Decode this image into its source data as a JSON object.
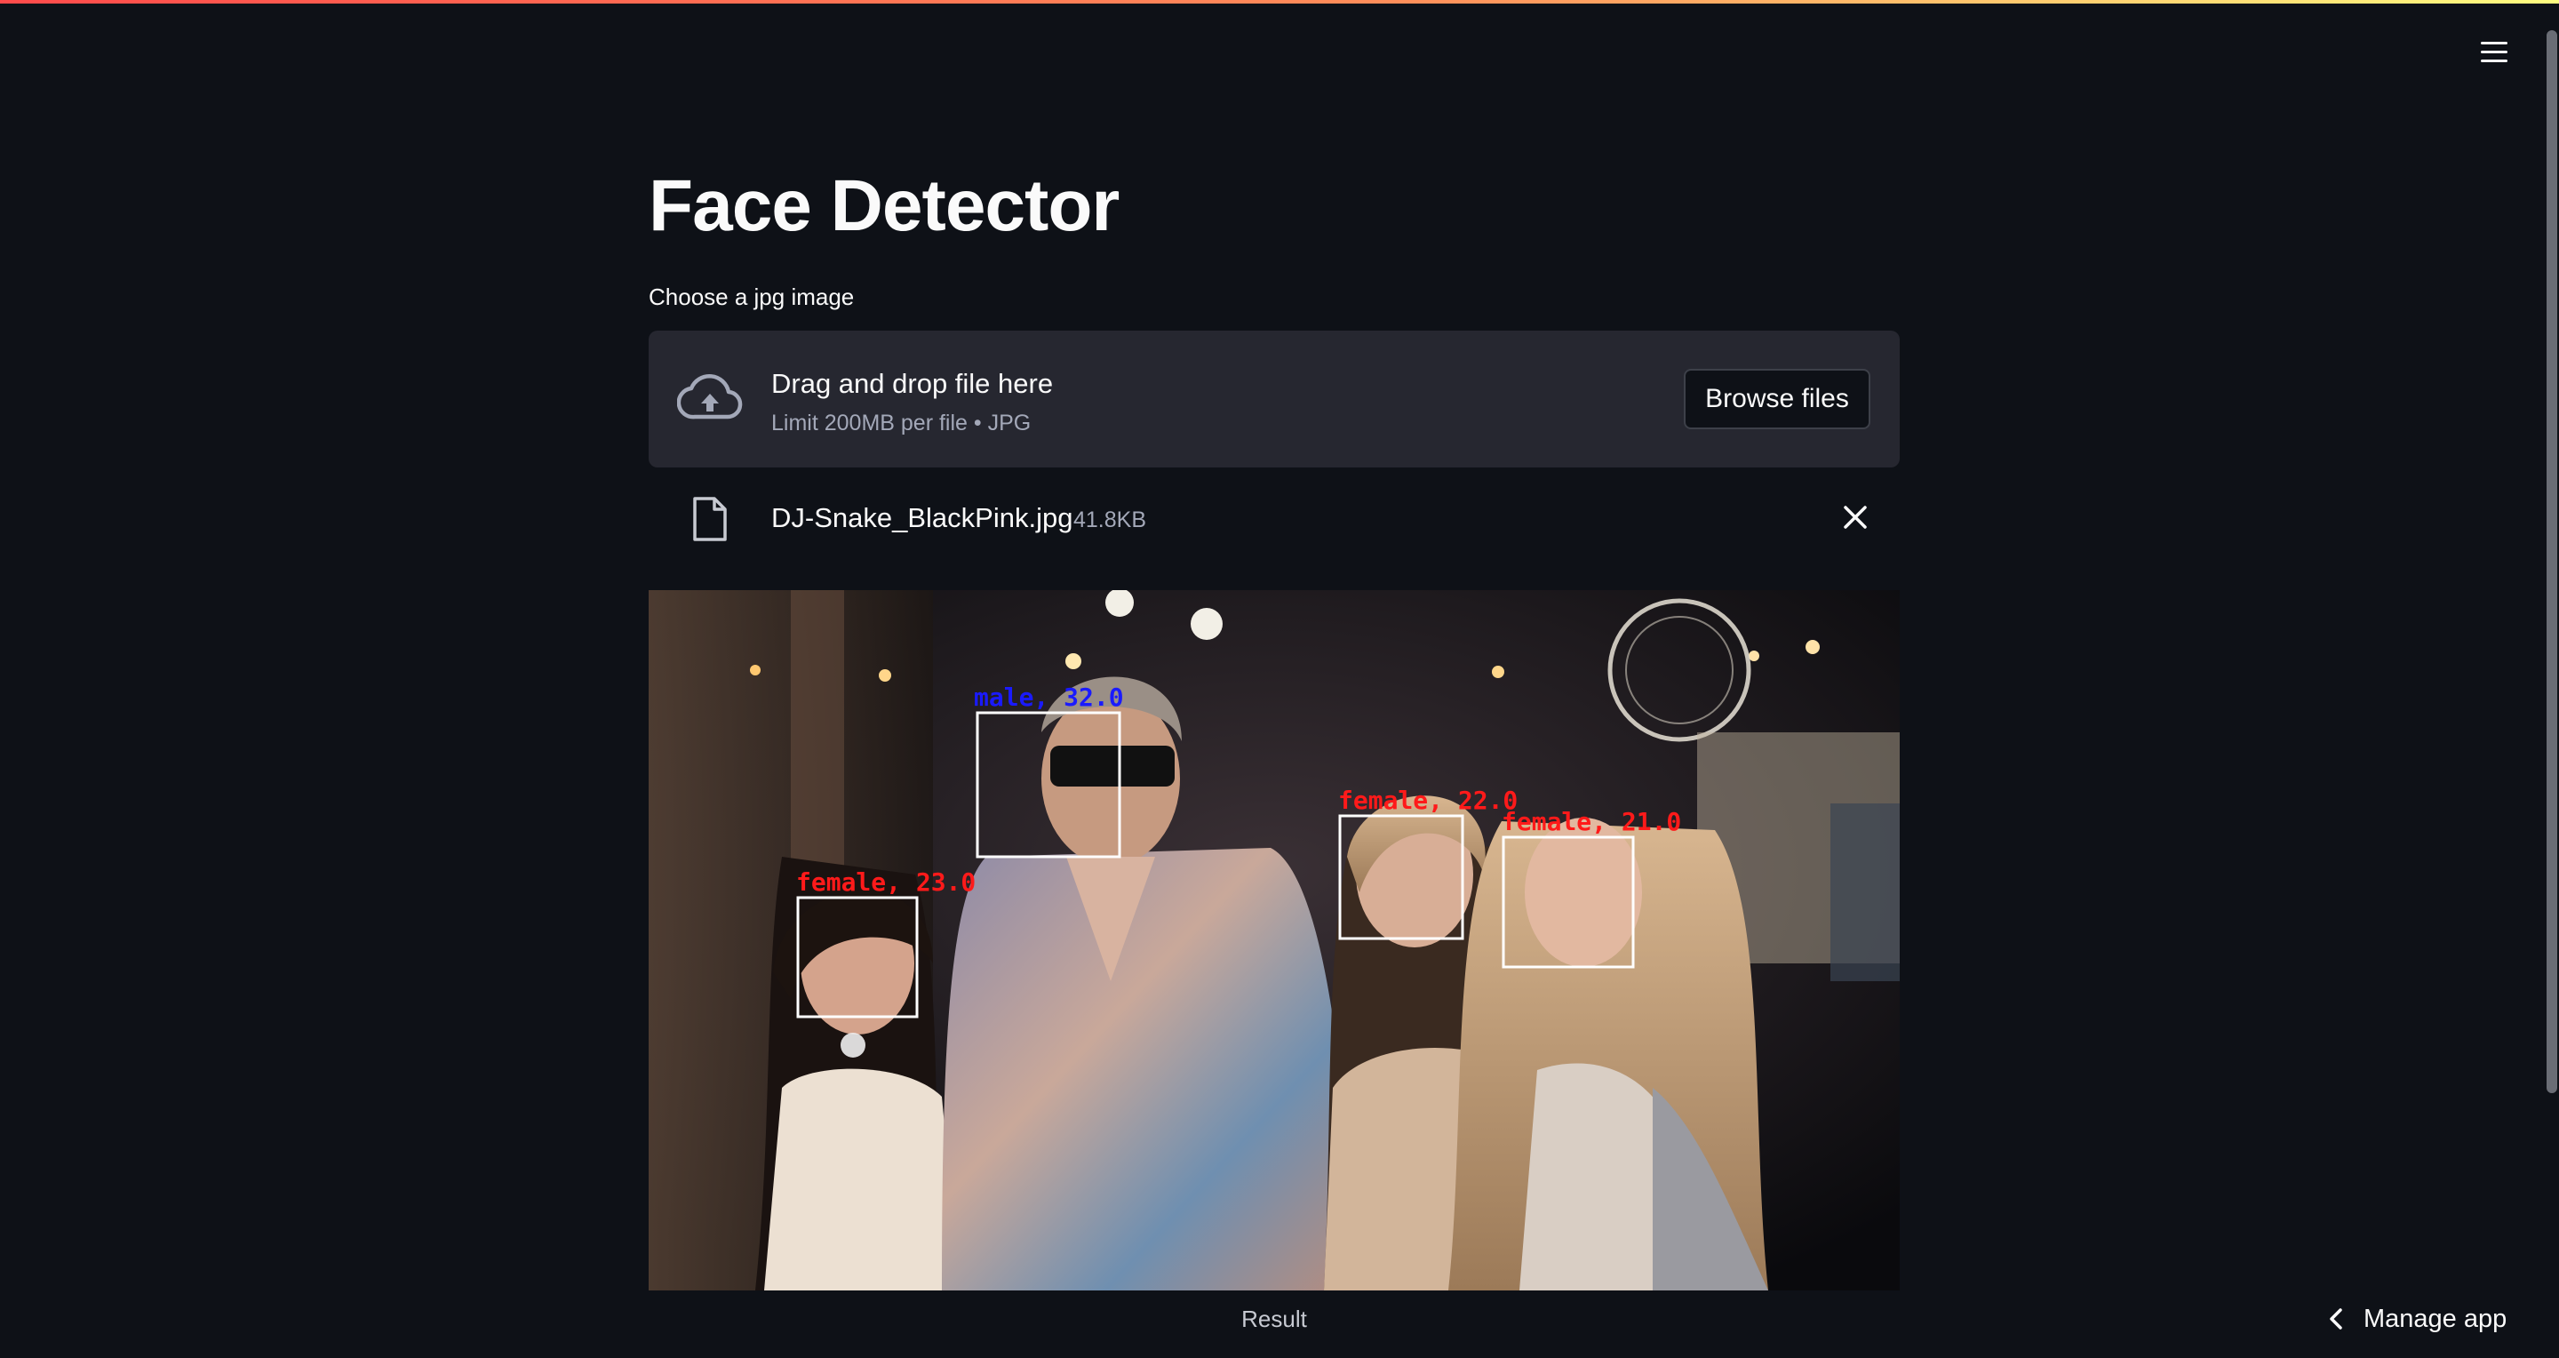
{
  "header": {
    "menu_icon": "hamburger-menu-icon"
  },
  "page": {
    "title": "Face Detector"
  },
  "uploader": {
    "label": "Choose a jpg image",
    "drop_text": "Drag and drop file here",
    "limit_text": "Limit 200MB per file • JPG",
    "browse_label": "Browse files",
    "upload_icon": "cloud-upload-icon"
  },
  "uploaded_file": {
    "name": "DJ-Snake_BlackPink.jpg",
    "size": "41.8KB",
    "file_icon": "file-icon",
    "remove_icon": "close-icon"
  },
  "result": {
    "caption": "Result",
    "detections": [
      {
        "label": "male, 32.0",
        "color": "#1a1aff"
      },
      {
        "label": "female, 23.0",
        "color": "#ff1a1a"
      },
      {
        "label": "female, 22.0",
        "color": "#ff1a1a"
      },
      {
        "label": "female, 21.0",
        "color": "#ff1a1a"
      }
    ]
  },
  "footer": {
    "manage_app_label": "Manage app",
    "chevron_icon": "chevron-left-icon"
  },
  "colors": {
    "background": "#0e1117",
    "dropzone": "#262730",
    "accent_top": "#ff4b4b"
  }
}
